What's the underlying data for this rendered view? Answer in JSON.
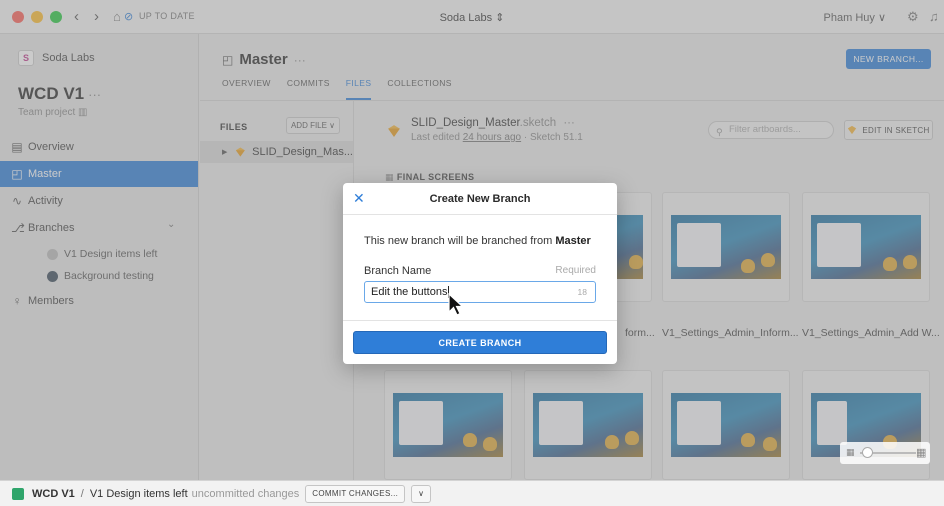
{
  "titlebar": {
    "status": "UP TO DATE",
    "title": "Soda Labs ⇕",
    "user": "Pham Huy ∨",
    "nav_back": "‹",
    "nav_forward": "›",
    "home_icon": "home-icon",
    "gear_icon": "gear-icon",
    "bell_icon": "bell-icon"
  },
  "sidebar": {
    "org_logo_text": "S",
    "org_name": "Soda Labs",
    "doc_title": "WCD V1",
    "doc_dots": "···",
    "doc_sub": "Team project ▥",
    "items": [
      {
        "label": "Overview",
        "icon": "▤"
      },
      {
        "label": "Master",
        "icon": "◰"
      },
      {
        "label": "Activity",
        "icon": "∿"
      },
      {
        "label": "Branches",
        "icon": "⎇",
        "chevron": "⌄"
      },
      {
        "label": "Members",
        "icon": "♀"
      }
    ],
    "branches": [
      {
        "label": "V1 Design items left",
        "color": "#bbbbbb"
      },
      {
        "label": "Background testing",
        "color": "#3a4a5a"
      }
    ]
  },
  "main": {
    "branch_name": "Master",
    "branch_dots": "···",
    "tabs": [
      "OVERVIEW",
      "COMMITS",
      "FILES",
      "COLLECTIONS"
    ],
    "active_tab": "FILES",
    "new_branch_label": "NEW BRANCH...",
    "files_label": "FILES",
    "add_file_label": "ADD FILE ∨",
    "file_name": "SLID_Design_Mas...",
    "doc_name": "SLID_Design_Master",
    "doc_ext": ".sketch",
    "doc_dots": "···",
    "doc_meta_prefix": "Last edited ",
    "doc_meta_time": "24 hours ago",
    "doc_meta_suffix": " · Sketch 51.1",
    "filter_placeholder": "Filter artboards...",
    "edit_label": "EDIT IN SKETCH",
    "section_title": "FINAL SCREENS",
    "artboards_row1": [
      "form...",
      "V1_Settings_Admin_Inform...",
      "V1_Settings_Admin_Add W..."
    ]
  },
  "modal": {
    "title": "Create New Branch",
    "text_prefix": "This new branch will be branched from ",
    "text_branch": "Master",
    "field_label": "Branch Name",
    "field_required": "Required",
    "field_value": "Edit the buttons",
    "field_count": "18",
    "button_label": "CREATE BRANCH"
  },
  "bottombar": {
    "project": "WCD V1",
    "sep": "/",
    "branch": "V1 Design items left",
    "uncommitted": "uncommitted changes",
    "commit_label": "COMMIT CHANGES...",
    "dropdown": "∨"
  },
  "colors": {
    "accent": "#2f7ed8",
    "sidebar_active": "#2f7ed8",
    "status_ok": "#2fa56b"
  }
}
